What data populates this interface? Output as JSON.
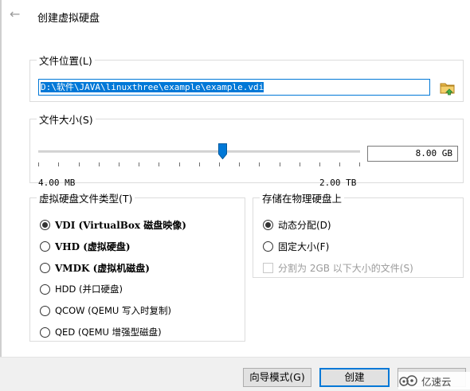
{
  "header": {
    "title": "创建虚拟硬盘",
    "back_icon": "back-arrow-icon"
  },
  "location": {
    "legend": "文件位置(L)",
    "path": "D:\\软件\\JAVA\\linuxthree\\example\\example.vdi",
    "folder_icon": "folder-browse-icon"
  },
  "size": {
    "legend": "文件大小(S)",
    "value": "8.00 GB",
    "min_label": "4.00 MB",
    "max_label": "2.00 TB"
  },
  "disk_type": {
    "legend": "虚拟硬盘文件类型(T)",
    "options": [
      {
        "label": "VDI (VirtualBox 磁盘映像)",
        "selected": true
      },
      {
        "label": "VHD (虚拟硬盘)",
        "selected": false
      },
      {
        "label": "VMDK (虚拟机磁盘)",
        "selected": false
      },
      {
        "label": "HDD (并口硬盘)",
        "selected": false
      },
      {
        "label": "QCOW (QEMU 写入时复制)",
        "selected": false
      },
      {
        "label": "QED (QEMU 增强型磁盘)",
        "selected": false
      }
    ]
  },
  "storage": {
    "legend": "存储在物理硬盘上",
    "options": [
      {
        "label": "动态分配(D)",
        "selected": true
      },
      {
        "label": "固定大小(F)",
        "selected": false
      }
    ],
    "split_label": "分割为 2GB 以下大小的文件(S)",
    "split_checked": false
  },
  "footer": {
    "wizard_label": "向导模式(G)",
    "create_label": "创建",
    "watermark_text": "亿速云"
  }
}
